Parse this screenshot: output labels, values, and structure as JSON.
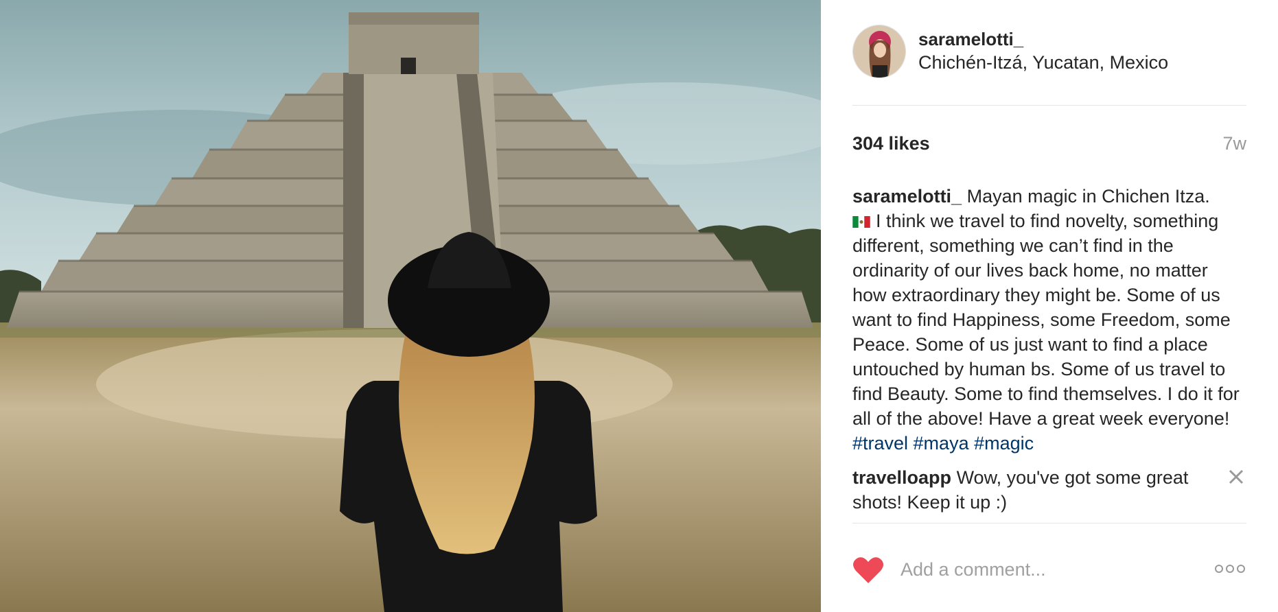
{
  "post": {
    "username": "saramelotti_",
    "location": "Chichén-Itzá, Yucatan, Mexico",
    "likes": "304 likes",
    "time": "7w",
    "caption": {
      "username": "saramelotti_",
      "text_before_flag": "Mayan magic in Chichen Itza.",
      "flag_icon": "mexico-flag-emoji",
      "text_after_flag": "I think we travel to find novelty, something different, something we can’t find in the ordinarity of our lives back home, no matter how extraordinary they might be. Some of us want to find Happiness, some Freedom, some Peace. Some of us just want to find a place untouched by human bs. Some of us travel to find Beauty. Some to find themselves. I do it for all of the above! Have a great week everyone!",
      "hashtags": "#travel #maya #magic"
    },
    "comments": [
      {
        "username": "travelloapp",
        "text": "Wow, you've got some great shots! Keep it up :)"
      }
    ],
    "comment_input": {
      "placeholder": "Add a comment..."
    },
    "icons": {
      "like": "heart-icon",
      "more": "more-options-icon",
      "remove_comment": "close-icon"
    },
    "colors": {
      "heart": "#ed4956",
      "hashtag": "#003569",
      "text": "#262626",
      "muted": "#999999"
    }
  }
}
